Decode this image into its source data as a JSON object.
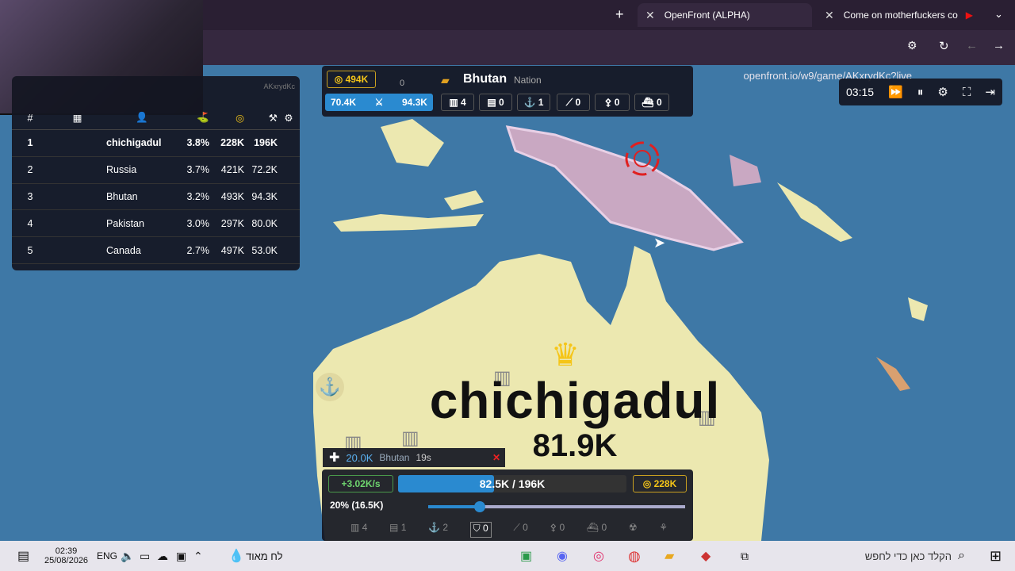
{
  "browser": {
    "tabs": [
      {
        "label": "OpenFront (ALPHA)"
      },
      {
        "label": "Come on motherfuckers co"
      }
    ],
    "url": "openfront.io/w9/game/AKxrydKc?live"
  },
  "leaderboard": {
    "game_id": "AKxrydKc",
    "headers": [
      "#"
    ],
    "rows": [
      {
        "rank": "1",
        "name": "chichigadul",
        "pct": "3.8%",
        "gold": "228K",
        "troops": "196K"
      },
      {
        "rank": "2",
        "name": "Russia",
        "pct": "3.7%",
        "gold": "421K",
        "troops": "72.2K"
      },
      {
        "rank": "3",
        "name": "Bhutan",
        "pct": "3.2%",
        "gold": "493K",
        "troops": "94.3K"
      },
      {
        "rank": "4",
        "name": "Pakistan",
        "pct": "3.0%",
        "gold": "297K",
        "troops": "80.0K"
      },
      {
        "rank": "5",
        "name": "Canada",
        "pct": "2.7%",
        "gold": "497K",
        "troops": "53.0K"
      }
    ]
  },
  "player_info": {
    "gold": "494K",
    "attacks": "0",
    "name": "Bhutan",
    "type": "Nation",
    "troops": "70.4K",
    "max_troops": "94.3K",
    "buildings": [
      {
        "icon": "city-icon",
        "value": "4"
      },
      {
        "icon": "factory-icon",
        "value": "0"
      },
      {
        "icon": "port-icon",
        "value": "1"
      },
      {
        "icon": "defense-icon",
        "value": "0"
      },
      {
        "icon": "missile-icon",
        "value": "0"
      },
      {
        "icon": "warship-icon",
        "value": "0"
      }
    ]
  },
  "controls": {
    "timer": "03:15"
  },
  "map_label": {
    "name": "chichigadul",
    "troops": "81.9K"
  },
  "notice": {
    "amount": "20.0K",
    "target": "Bhutan",
    "time": "19s"
  },
  "bottom_panel": {
    "rate": "+3.02K/s",
    "population": "82.5K / 196K",
    "gold": "228K",
    "attack_ratio": "20% (16.5K)",
    "attack_ratio_fraction": 0.2,
    "build_counts": [
      "4",
      "1",
      "2",
      "0",
      "0",
      "0",
      "0"
    ]
  },
  "taskbar": {
    "time": "02:39",
    "date": "25/08/2026",
    "lang": "ENG",
    "weather": "לח מאוד",
    "search": "הקלד כאן כדי לחפש"
  }
}
